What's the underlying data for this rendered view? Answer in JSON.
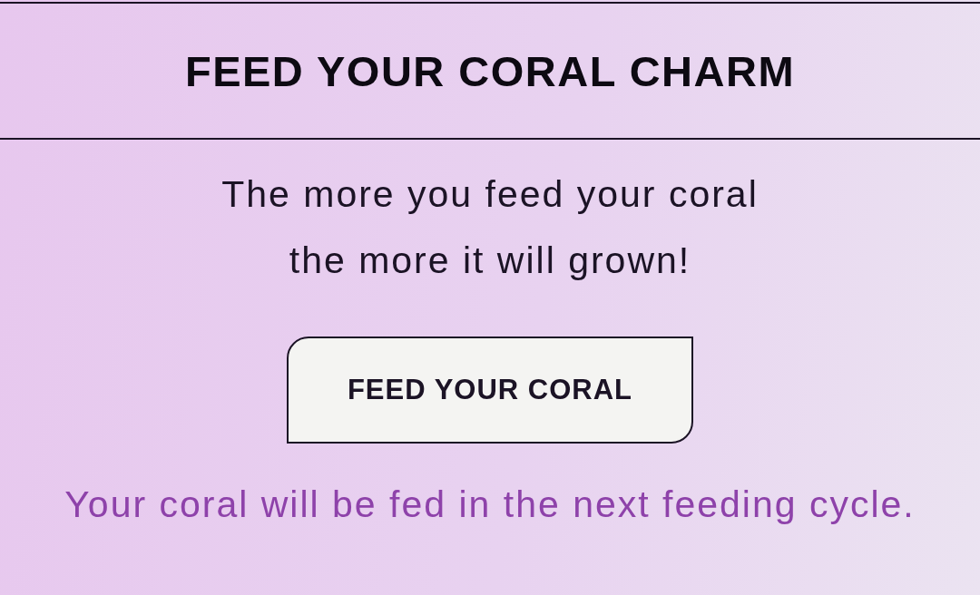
{
  "header": {
    "title": "FEED YOUR CORAL CHARM"
  },
  "intro": {
    "lines": [
      "The more you feed your coral",
      "the more it will grown!"
    ]
  },
  "feed_button": {
    "label": "FEED YOUR CORAL"
  },
  "status_message": "Your coral will be fed in the next feeding cycle."
}
